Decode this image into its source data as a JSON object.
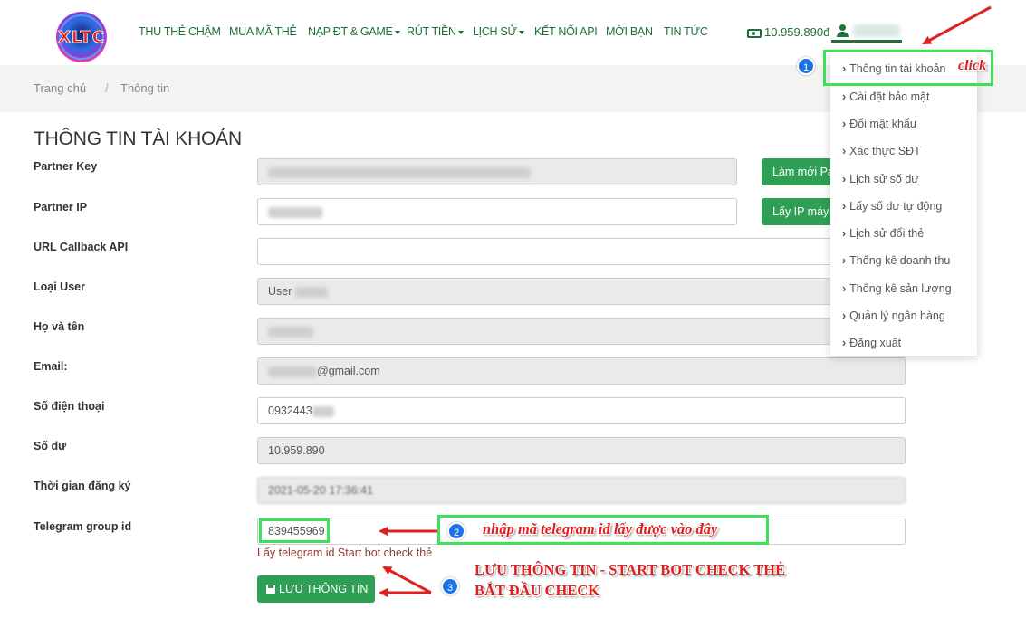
{
  "nav": {
    "logo_text": "XLTC",
    "items": [
      "THU THẺ CHẬM",
      "MUA MÃ THẺ",
      "NẠP ĐT & GAME",
      "RÚT TIỀN",
      "LỊCH SỬ",
      "KẾT NỐI API",
      "MỜI BẠN",
      "TIN TỨC"
    ],
    "balance": "10.959.890đ",
    "icons": {
      "balance": "money-icon",
      "user": "user-icon"
    }
  },
  "breadcrumb": {
    "home": "Trang chủ",
    "separator": "/",
    "current": "Thông tin"
  },
  "page_title": "THÔNG TIN TÀI KHOẢN",
  "form": {
    "partner_key": {
      "label": "Partner Key",
      "button": "Làm mới Partner Key"
    },
    "partner_ip": {
      "label": "Partner IP",
      "button": "Lấy IP máy chủ"
    },
    "url_callback": {
      "label": "URL Callback API",
      "value": ""
    },
    "user_type": {
      "label": "Loại User",
      "value": "User"
    },
    "full_name": {
      "label": "Họ và tên"
    },
    "email": {
      "label": "Email:",
      "value_suffix": "@gmail.com"
    },
    "phone": {
      "label": "Số điện thoại",
      "value": "0932443"
    },
    "balance": {
      "label": "Số dư",
      "value": "10.959.890"
    },
    "registered": {
      "label": "Thời gian đăng ký",
      "value": "2021-05-20 17:36:41"
    },
    "telegram": {
      "label": "Telegram group id",
      "value": "839455969",
      "help": "Lấy telegram id Start bot check thẻ"
    },
    "save_button": "LƯU THÔNG TIN"
  },
  "dropdown": {
    "items": [
      "Thông tin tài khoản",
      "Cài đặt bảo mật",
      "Đổi mật khẩu",
      "Xác thực SĐT",
      "Lịch sử số dư",
      "Lấy số dư tự động",
      "Lịch sử đổi thẻ",
      "Thống kê doanh thu",
      "Thống kê sản lượng",
      "Quản lý ngân hàng",
      "Đăng xuất"
    ]
  },
  "annotations": {
    "badge_1": "1",
    "click": "click",
    "badge_2": "2",
    "step2_text": "nhập mã telegram id lấy được vào đây",
    "badge_3": "3",
    "step3_line1": "LƯU THÔNG TIN - START BOT CHECK THẺ",
    "step3_line2": "BẮT ĐẦU CHECK",
    "accent_red": "#e02020",
    "highlight_green": "#3ee05a",
    "badge_blue": "#1a73e8"
  }
}
